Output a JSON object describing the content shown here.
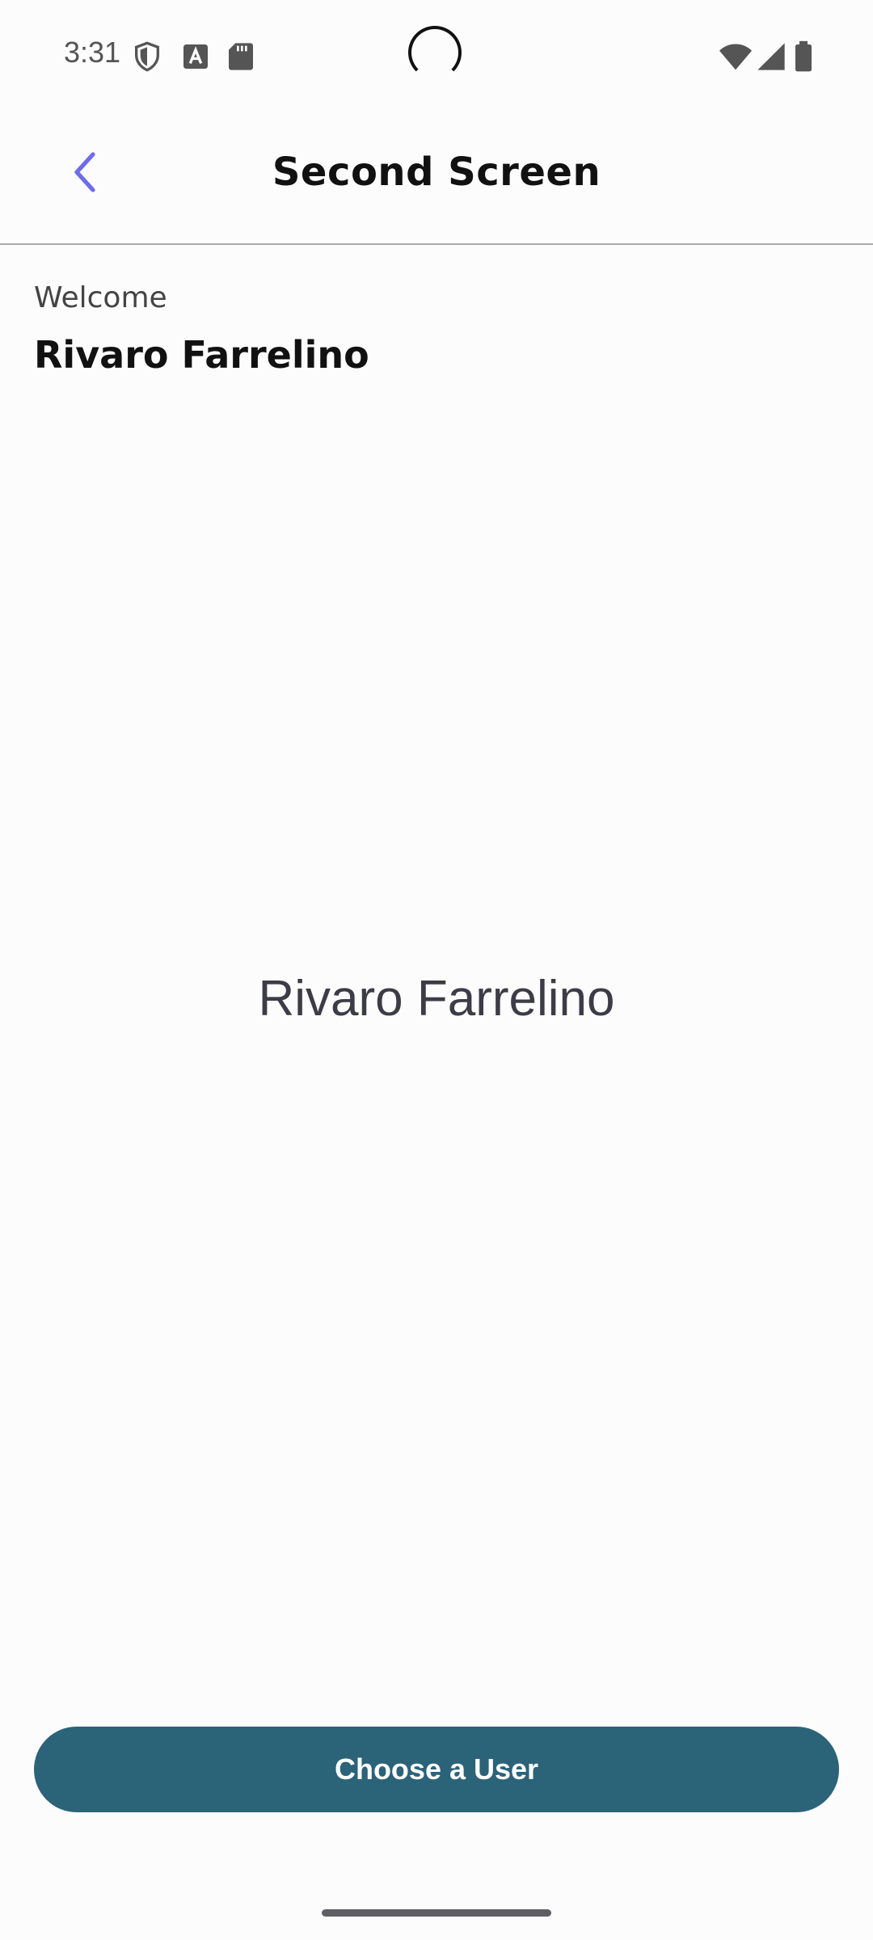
{
  "status_bar": {
    "time": "3:31",
    "left_icons": [
      "shield-icon",
      "keyboard-a-icon",
      "sd-card-icon"
    ],
    "right_icons": [
      "wifi-icon",
      "signal-icon",
      "battery-icon"
    ]
  },
  "app_bar": {
    "title": "Second Screen",
    "back_icon": "chevron-left-icon",
    "accent_color": "#6c6cf0"
  },
  "welcome": {
    "label": "Welcome",
    "name": "Rivaro Farrelino"
  },
  "main": {
    "selected_user_name": "Rivaro Farrelino"
  },
  "footer": {
    "choose_button_label": "Choose a User",
    "button_color": "#2b6379"
  }
}
